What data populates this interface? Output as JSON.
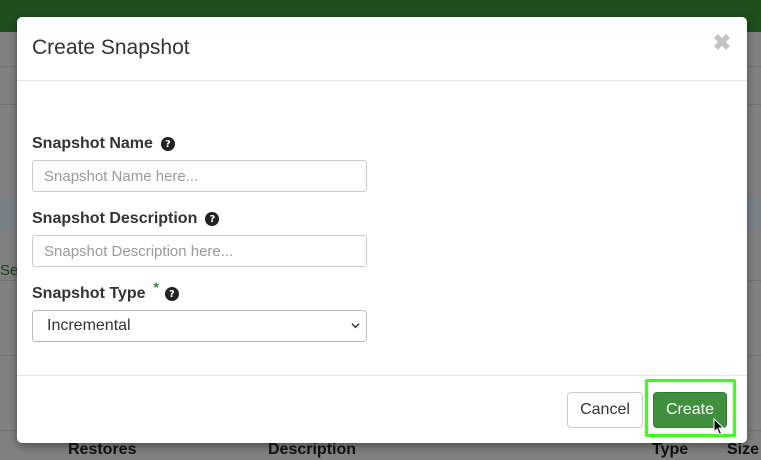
{
  "modal": {
    "title": "Create Snapshot",
    "close_glyph": "✖"
  },
  "form": {
    "name": {
      "label": "Snapshot Name",
      "placeholder": "Snapshot Name here...",
      "value": ""
    },
    "description": {
      "label": "Snapshot Description",
      "placeholder": "Snapshot Description here...",
      "value": ""
    },
    "type": {
      "label": "Snapshot Type",
      "required_marker": "*",
      "selected": "Incremental"
    },
    "help_glyph": "?"
  },
  "footer": {
    "cancel_label": "Cancel",
    "create_label": "Create"
  },
  "background": {
    "partial_link": "Sea",
    "columns": [
      "Restores",
      "Description",
      "Type",
      "Size"
    ]
  },
  "colors": {
    "primary_button": "#3f8f3c",
    "highlight": "#3cff1e",
    "required": "#2e8b2e",
    "topbar": "#1e4f1c"
  },
  "icons": {
    "close": "close-icon",
    "help": "question-circle-icon",
    "select_caret": "chevron-down-icon",
    "cursor": "mouse-pointer-icon"
  }
}
